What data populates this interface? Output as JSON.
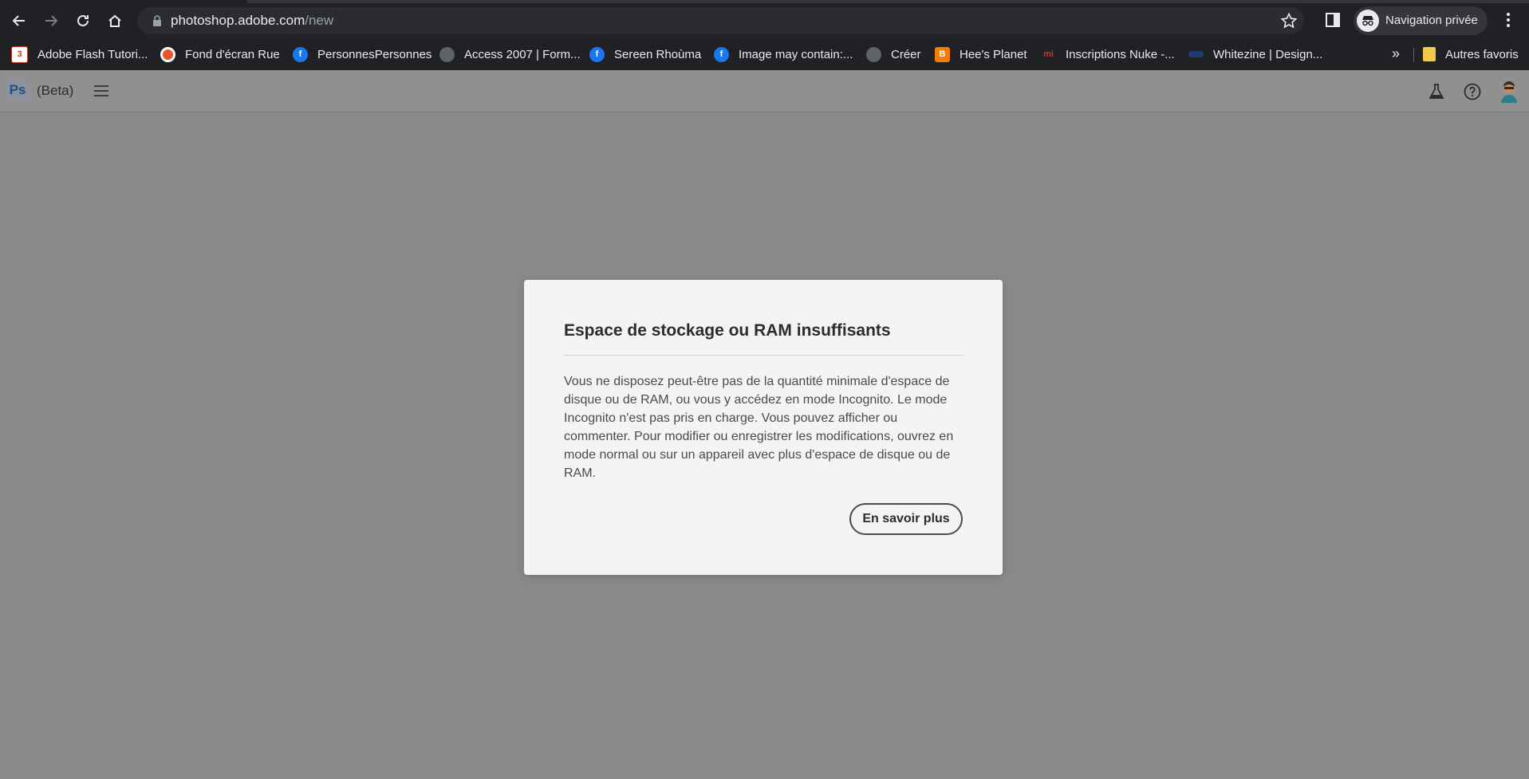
{
  "browser": {
    "url_host": "photoshop.adobe.com",
    "url_path": "/new",
    "profile_label": "Navigation privée",
    "bookmarks": [
      {
        "label": "Adobe Flash Tutori...",
        "icon": "c3-icon",
        "color": "#ffffff"
      },
      {
        "label": "Fond d'écran Rue",
        "icon": "record-icon",
        "color": "#e8552b"
      },
      {
        "label": "PersonnesPersonnes",
        "icon": "facebook-icon",
        "color": "#1877f2"
      },
      {
        "label": "Access 2007 | Form...",
        "icon": "globe-icon",
        "color": "#5f6368"
      },
      {
        "label": "Sereen Rhoùma",
        "icon": "facebook-icon",
        "color": "#1877f2"
      },
      {
        "label": "Image may contain:...",
        "icon": "facebook-icon",
        "color": "#1877f2"
      },
      {
        "label": "Créer",
        "icon": "globe-icon",
        "color": "#5f6368"
      },
      {
        "label": "Hee's Planet",
        "icon": "blogger-icon",
        "color": "#f57d00"
      },
      {
        "label": "Inscriptions Nuke -...",
        "icon": "mi-icon",
        "color": "#c0392b"
      },
      {
        "label": "Whitezine | Design...",
        "icon": "wz-icon",
        "color": "#1d3c6e"
      }
    ],
    "more_bookmarks": "»",
    "other_favorites": "Autres favoris"
  },
  "app": {
    "logo_text": "Ps",
    "beta_label": "(Beta)"
  },
  "dialog": {
    "title": "Espace de stockage ou RAM insuffisants",
    "body": "Vous ne disposez peut-être pas de la quantité minimale d'espace de disque ou de RAM, ou vous y accédez en mode Incognito. Le mode Incognito n'est pas pris en charge. Vous pouvez afficher ou commenter. Pour modifier ou enregistrer les modifications, ouvrez en mode normal ou sur un appareil avec plus d'espace de disque ou de RAM.",
    "learn_more": "En savoir plus"
  }
}
